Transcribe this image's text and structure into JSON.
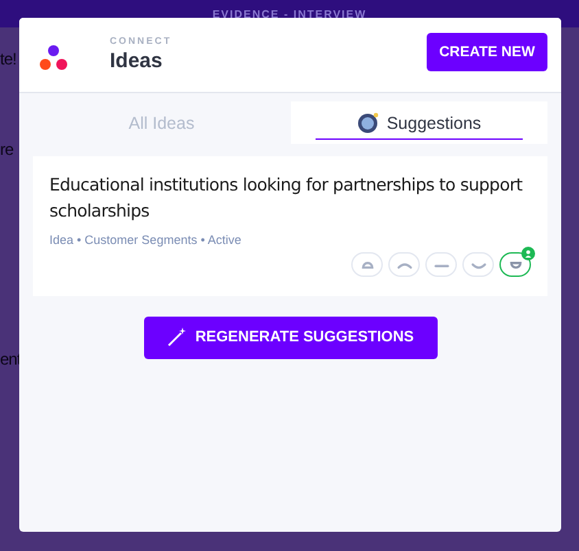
{
  "background": {
    "banner": "EVIDENCE - INTERVIEW",
    "fragments": [
      "te!",
      "re",
      "ent"
    ]
  },
  "modal": {
    "eyebrow": "CONNECT",
    "title": "Ideas",
    "create_button": "CREATE NEW"
  },
  "tabs": [
    {
      "label": "All Ideas",
      "selected": false,
      "icon": false
    },
    {
      "label": "Suggestions",
      "selected": true,
      "icon": true
    }
  ],
  "suggestion": {
    "title": "Educational institutions looking for partnerships to support scholarships",
    "meta": "Idea • Customer Segments • Active",
    "reactions": [
      {
        "kind": "very-sad",
        "selected": false
      },
      {
        "kind": "sad",
        "selected": false
      },
      {
        "kind": "neutral",
        "selected": false
      },
      {
        "kind": "happy",
        "selected": false
      },
      {
        "kind": "very-happy",
        "selected": true
      }
    ]
  },
  "regenerate_button": "REGENERATE SUGGESTIONS"
}
